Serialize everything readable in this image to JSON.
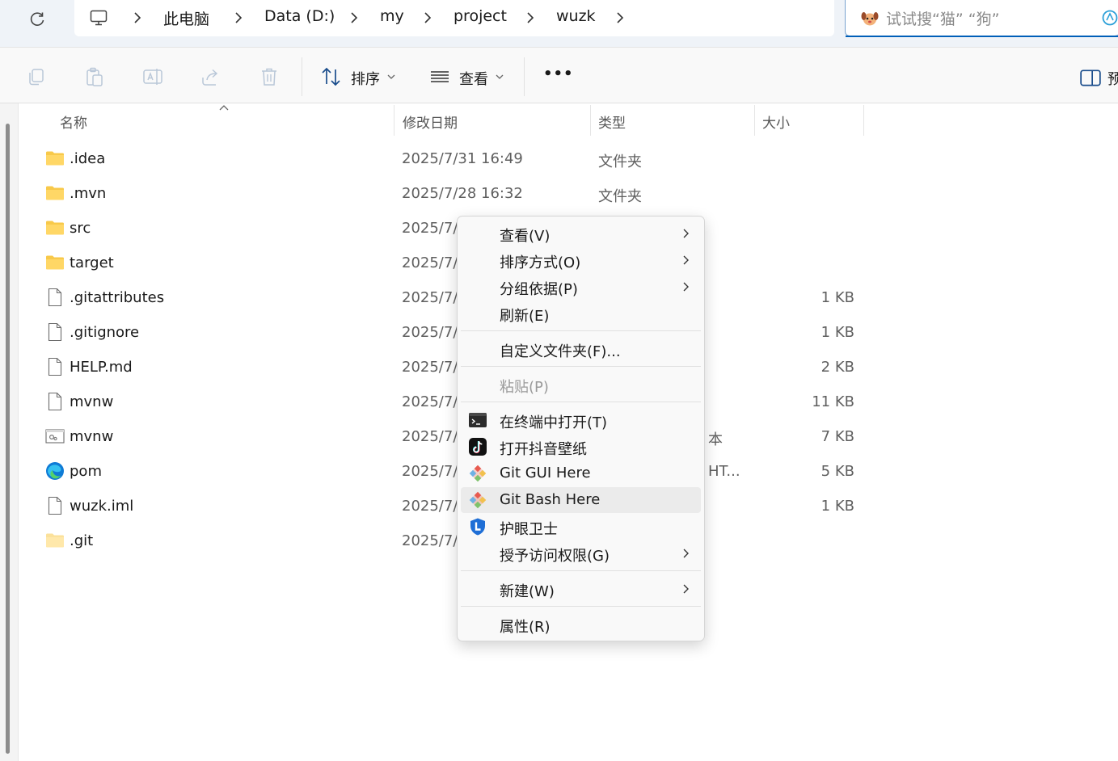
{
  "breadcrumb": {
    "items": [
      "此电脑",
      "Data (D:)",
      "my",
      "project",
      "wuzk"
    ]
  },
  "search": {
    "placeholder": "试试搜“猫” “狗”"
  },
  "toolbar": {
    "sort_label": "排序",
    "view_label": "查看",
    "more_label": "•••",
    "preview_label": "预"
  },
  "columns": {
    "name": "名称",
    "date": "修改日期",
    "type": "类型",
    "size": "大小"
  },
  "files": [
    {
      "name": ".idea",
      "date": "2025/7/31 16:49",
      "type": "文件夹",
      "size": "",
      "icon": "folder-icon"
    },
    {
      "name": ".mvn",
      "date": "2025/7/28 16:32",
      "type": "文件夹",
      "size": "",
      "icon": "folder-icon"
    },
    {
      "name": "src",
      "date": "2025/7/",
      "type": "",
      "size": "",
      "icon": "folder-icon"
    },
    {
      "name": "target",
      "date": "2025/7/",
      "type": "",
      "size": "",
      "icon": "folder-icon"
    },
    {
      "name": ".gitattributes",
      "date": "2025/7/",
      "type": "",
      "size": "1 KB",
      "icon": "file-icon"
    },
    {
      "name": ".gitignore",
      "date": "2025/7/",
      "type": "",
      "size": "1 KB",
      "icon": "file-icon"
    },
    {
      "name": "HELP.md",
      "date": "2025/7/",
      "type": "",
      "size": "2 KB",
      "icon": "file-icon"
    },
    {
      "name": "mvnw",
      "date": "2025/7/",
      "type": "",
      "size": "11 KB",
      "icon": "file-icon"
    },
    {
      "name": "mvnw",
      "date": "2025/7/",
      "type": "本",
      "size": "7 KB",
      "icon": "script-icon"
    },
    {
      "name": "pom",
      "date": "2025/7/",
      "type": "HT...",
      "size": "5 KB",
      "icon": "edge-icon"
    },
    {
      "name": "wuzk.iml",
      "date": "2025/7/",
      "type": "",
      "size": "1 KB",
      "icon": "file-icon"
    },
    {
      "name": ".git",
      "date": "2025/7/",
      "type": "",
      "size": "",
      "icon": "folder-hidden-icon"
    }
  ],
  "context_menu": {
    "view": "查看(V)",
    "sort_by": "排序方式(O)",
    "group_by": "分组依据(P)",
    "refresh": "刷新(E)",
    "customize": "自定义文件夹(F)...",
    "paste": "粘贴(P)",
    "open_terminal": "在终端中打开(T)",
    "douyin_wallpaper": "打开抖音壁纸",
    "git_gui": "Git GUI Here",
    "git_bash": "Git Bash Here",
    "eye_guard": "护眼卫士",
    "grant_access": "授予访问权限(G)",
    "new": "新建(W)",
    "properties": "属性(R)"
  },
  "colors": {
    "folder": "#f8c94a",
    "accent": "#005fb8",
    "menu_hover": "#ebebeb"
  }
}
